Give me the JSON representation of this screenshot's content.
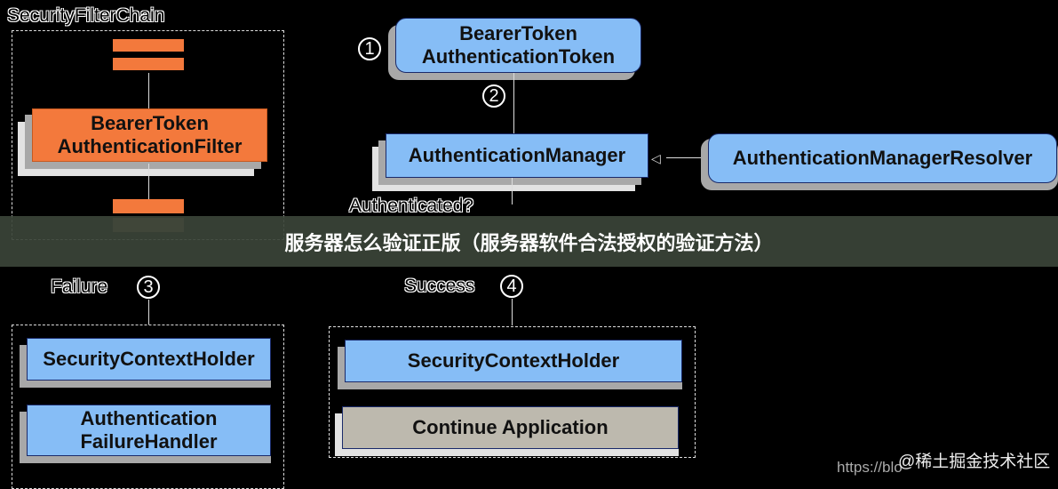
{
  "filter_chain": {
    "title": "SecurityFilterChain",
    "filter": "BearerToken AuthenticationFilter"
  },
  "token": {
    "label": "BearerToken AuthenticationToken",
    "step": "1"
  },
  "manager": {
    "label": "AuthenticationManager",
    "step": "2"
  },
  "resolver": {
    "label": "AuthenticationManagerResolver"
  },
  "decision": "Authenticated?",
  "failure": {
    "label": "Failure",
    "step": "3",
    "holder": "SecurityContextHolder",
    "handler": "Authentication FailureHandler"
  },
  "success": {
    "label": "Success",
    "step": "4",
    "holder": "SecurityContextHolder",
    "continue": "Continue Application"
  },
  "banner": "服务器怎么验证正版（服务器软件合法授权的验证方法）",
  "watermark": {
    "url": "https://blo",
    "site": "@稀土掘金技术社区"
  },
  "colors": {
    "blue": "#86bdf6",
    "orange": "#f3793c",
    "gray": "#bdb9ae"
  }
}
